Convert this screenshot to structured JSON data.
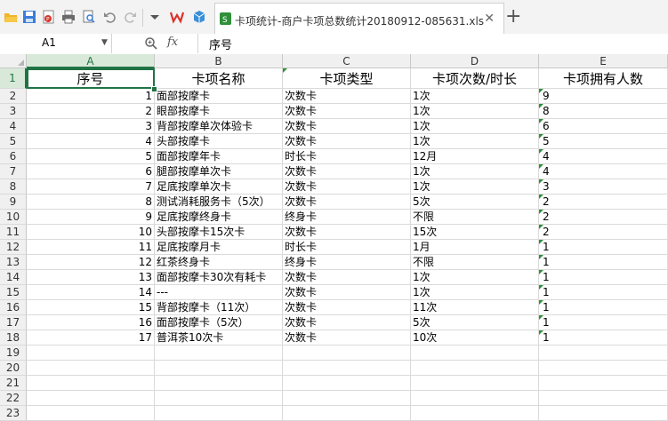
{
  "toolbar": {
    "icons": [
      "open-folder-icon",
      "save-icon",
      "export-pdf-icon",
      "print-icon",
      "print-preview-icon",
      "undo-icon",
      "redo-icon",
      "dropdown-icon",
      "wps-logo-icon",
      "cube-icon"
    ],
    "active_tab": "卡项统计-商户卡项总数统计20180912-085631.xls",
    "close_glyph": "✕",
    "new_tab_glyph": "+"
  },
  "formula_bar": {
    "cell_ref": "A1",
    "fx_label": "fx",
    "content": "序号"
  },
  "columns": [
    "A",
    "B",
    "C",
    "D",
    "E"
  ],
  "header_row": [
    "序号",
    "卡项名称",
    "卡项类型",
    "卡项次数/时长",
    "卡项拥有人数"
  ],
  "rows": [
    [
      "1",
      "面部按摩卡",
      "次数卡",
      "1次",
      "9"
    ],
    [
      "2",
      "眼部按摩卡",
      "次数卡",
      "1次",
      "8"
    ],
    [
      "3",
      "背部按摩单次体验卡",
      "次数卡",
      "1次",
      "6"
    ],
    [
      "4",
      "头部按摩卡",
      "次数卡",
      "1次",
      "5"
    ],
    [
      "5",
      "面部按摩年卡",
      "时长卡",
      "12月",
      "4"
    ],
    [
      "6",
      "腿部按摩单次卡",
      "次数卡",
      "1次",
      "4"
    ],
    [
      "7",
      "足底按摩单次卡",
      "次数卡",
      "1次",
      "3"
    ],
    [
      "8",
      "测试消耗服务卡（5次）",
      "次数卡",
      "5次",
      "2"
    ],
    [
      "9",
      "足底按摩终身卡",
      "终身卡",
      "不限",
      "2"
    ],
    [
      "10",
      "头部按摩卡15次卡",
      "次数卡",
      "15次",
      "2"
    ],
    [
      "11",
      "足底按摩月卡",
      "时长卡",
      "1月",
      "1"
    ],
    [
      "12",
      "红茶终身卡",
      "终身卡",
      "不限",
      "1"
    ],
    [
      "13",
      "面部按摩卡30次有耗卡",
      "次数卡",
      "1次",
      "1"
    ],
    [
      "14",
      "---",
      "次数卡",
      "1次",
      "1"
    ],
    [
      "15",
      "背部按摩卡（11次）",
      "次数卡",
      "11次",
      "1"
    ],
    [
      "16",
      "面部按摩卡（5次）",
      "次数卡",
      "5次",
      "1"
    ],
    [
      "17",
      "普洱茶10次卡",
      "次数卡",
      "10次",
      "1"
    ]
  ],
  "row_numbers": [
    "1",
    "2",
    "3",
    "4",
    "5",
    "6",
    "7",
    "8",
    "9",
    "10",
    "11",
    "12",
    "13",
    "14",
    "15",
    "16",
    "17",
    "18",
    "19",
    "20",
    "21",
    "22",
    "23"
  ],
  "colors": {
    "accent": "#217346",
    "marker": "#2f8f3a"
  }
}
